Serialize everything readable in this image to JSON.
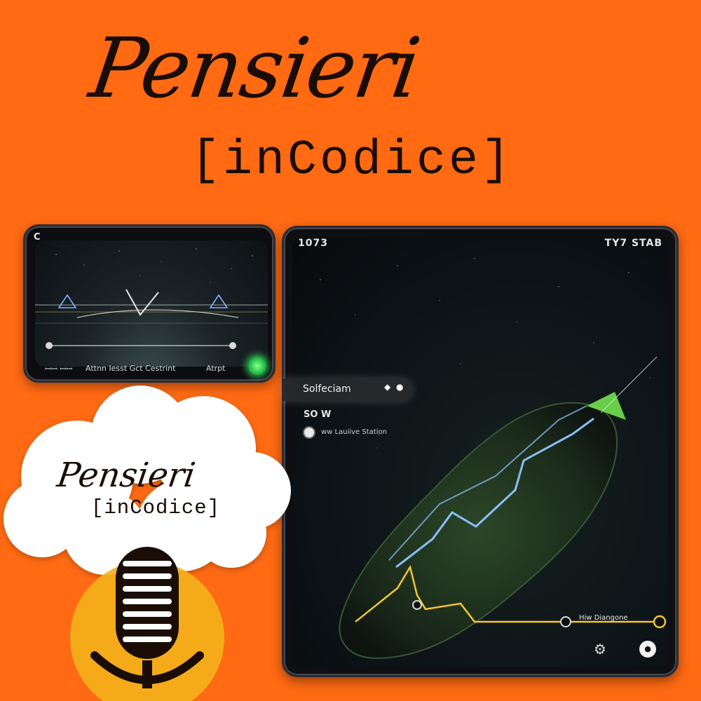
{
  "title": {
    "script": "Pensieri",
    "mono": "[inCodice]"
  },
  "small_phone": {
    "status_left": "C",
    "bottom_left": "ꟷꟷ ꟷꟷ",
    "bottom_center": "Attnn Iesst Gct Cestrint",
    "bottom_right": "Atrpt",
    "accent_color": "#23c54a"
  },
  "tablet": {
    "time": "1073",
    "status_right": "TY7 STAB",
    "search_label": "Solfeciam",
    "search_icons": "◆ ●",
    "distance": "SO W",
    "station_label": "ww Lauiive Station",
    "route_end_label": "Hiw Diangone",
    "bottom_left_icon": "route-icon",
    "bottom_right_icon": "record-icon",
    "route_colors": {
      "blue": "#8fc6ff",
      "yellow": "#f4c733",
      "green": "#6ed84a"
    }
  },
  "cloud_logo": {
    "script": "Pensieri",
    "mono": "[inCodice]",
    "mic_accent": "#f4b21b"
  },
  "background_color": "#ff6a13"
}
